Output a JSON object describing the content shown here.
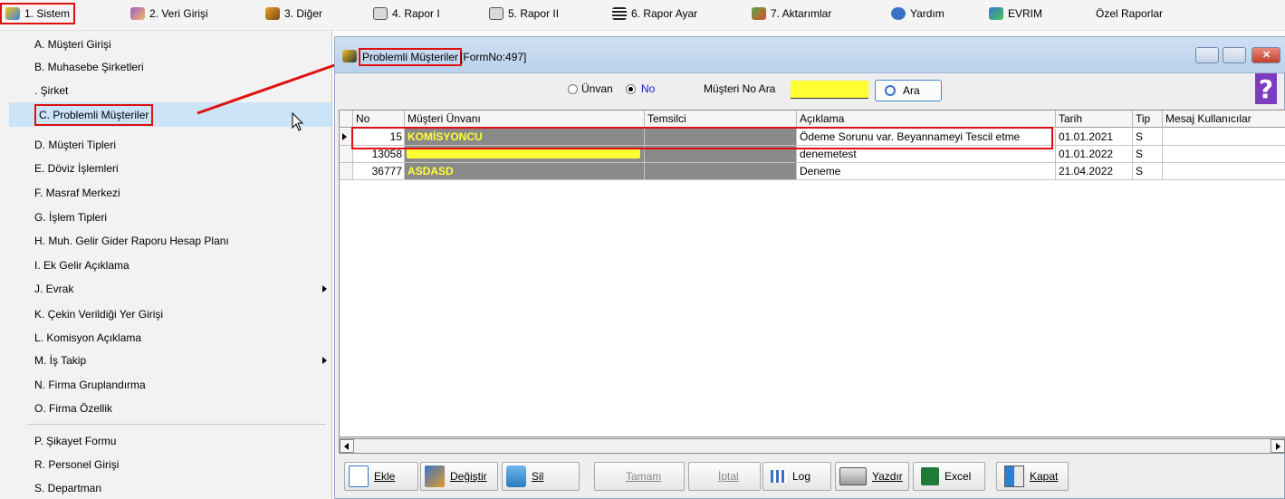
{
  "menubar": {
    "items": [
      {
        "label": "1.  Sistem",
        "icon": "system-icon"
      },
      {
        "label": "2.  Veri Girişi",
        "icon": "data-entry-icon"
      },
      {
        "label": "3.  Diğer",
        "icon": "other-icon"
      },
      {
        "label": "4.  Rapor I",
        "icon": "printer-icon"
      },
      {
        "label": "5.  Rapor II",
        "icon": "printer-icon"
      },
      {
        "label": "6.  Rapor Ayar",
        "icon": "report-settings-icon"
      },
      {
        "label": "7.  Aktarımlar",
        "icon": "transfer-icon"
      },
      {
        "label": "Yardım",
        "icon": "help-icon"
      },
      {
        "label": "EVRIM",
        "icon": "evrim-icon"
      },
      {
        "label": "Özel Raporlar",
        "icon": ""
      }
    ]
  },
  "dropdown": {
    "items": [
      {
        "label": "A.  Müşteri Girişi"
      },
      {
        "label": "B.  Muhasebe Şirketleri"
      },
      {
        "label": ".  Şirket"
      },
      {
        "label": "C.  Problemli Müşteriler",
        "selected": true
      },
      {
        "label": "D.  Müşteri Tipleri"
      },
      {
        "label": "E.  Döviz İşlemleri"
      },
      {
        "label": "F.  Masraf Merkezi"
      },
      {
        "label": "G.  İşlem Tipleri"
      },
      {
        "label": "H.  Muh. Gelir Gider Raporu Hesap Planı"
      },
      {
        "label": "I.  Ek Gelir Açıklama"
      },
      {
        "label": "J.  Evrak",
        "submenu": true
      },
      {
        "label": "K.  Çekin Verildiği Yer Girişi"
      },
      {
        "label": "L.  Komisyon Açıklama"
      },
      {
        "label": "M.  İş Takip",
        "submenu": true
      },
      {
        "label": "N.  Firma Gruplandırma"
      },
      {
        "label": "O.  Firma Özellik"
      },
      {
        "label": "P.  Şikayet Formu"
      },
      {
        "label": "R.  Personel Girişi"
      },
      {
        "label": "S.  Departman"
      }
    ]
  },
  "window": {
    "title": "Problemli Müşteriler",
    "form_no": "[FormNo:497]",
    "help_glyph": "?",
    "search": {
      "radio_unvan": "Ünvan",
      "radio_no": "No",
      "selected": "No",
      "label": "Müşteri No Ara",
      "value": "",
      "button": "Ara"
    },
    "grid": {
      "columns": [
        "No",
        "Müşteri Ünvanı",
        "Temsilci",
        "Açıklama",
        "Tarih",
        "Tip",
        "Mesaj Kullanıcılar"
      ],
      "rows": [
        {
          "no": "15",
          "unvan": "KOMİSYONCU",
          "temsilci": "",
          "aciklama": "Ödeme Sorunu var. Beyannameyi Tescil etme",
          "tarih": "01.01.2021",
          "tip": "S",
          "mesaj": ""
        },
        {
          "no": "13058",
          "unvan": "",
          "temsilci": "",
          "aciklama": "denemetest",
          "tarih": "01.01.2022",
          "tip": "S",
          "mesaj": ""
        },
        {
          "no": "36777",
          "unvan": "ASDASD",
          "temsilci": "",
          "aciklama": "Deneme",
          "tarih": "21.04.2022",
          "tip": "S",
          "mesaj": ""
        }
      ]
    },
    "toolbar": {
      "ekle": "Ekle",
      "degistir": "Değiştir",
      "sil": "Sil",
      "tamam": "Tamam",
      "iptal": "İptal",
      "log": "Log",
      "yazdir": "Yazdır",
      "excel": "Excel",
      "kapat": "Kapat"
    }
  },
  "colors": {
    "highlight": "#e01010",
    "selection": "#cce4f7",
    "cell_dark": "#8a8a8a",
    "cell_yellow_text": "#ffff33",
    "search_input": "#ffff33",
    "help_button": "#7b3cbf"
  }
}
